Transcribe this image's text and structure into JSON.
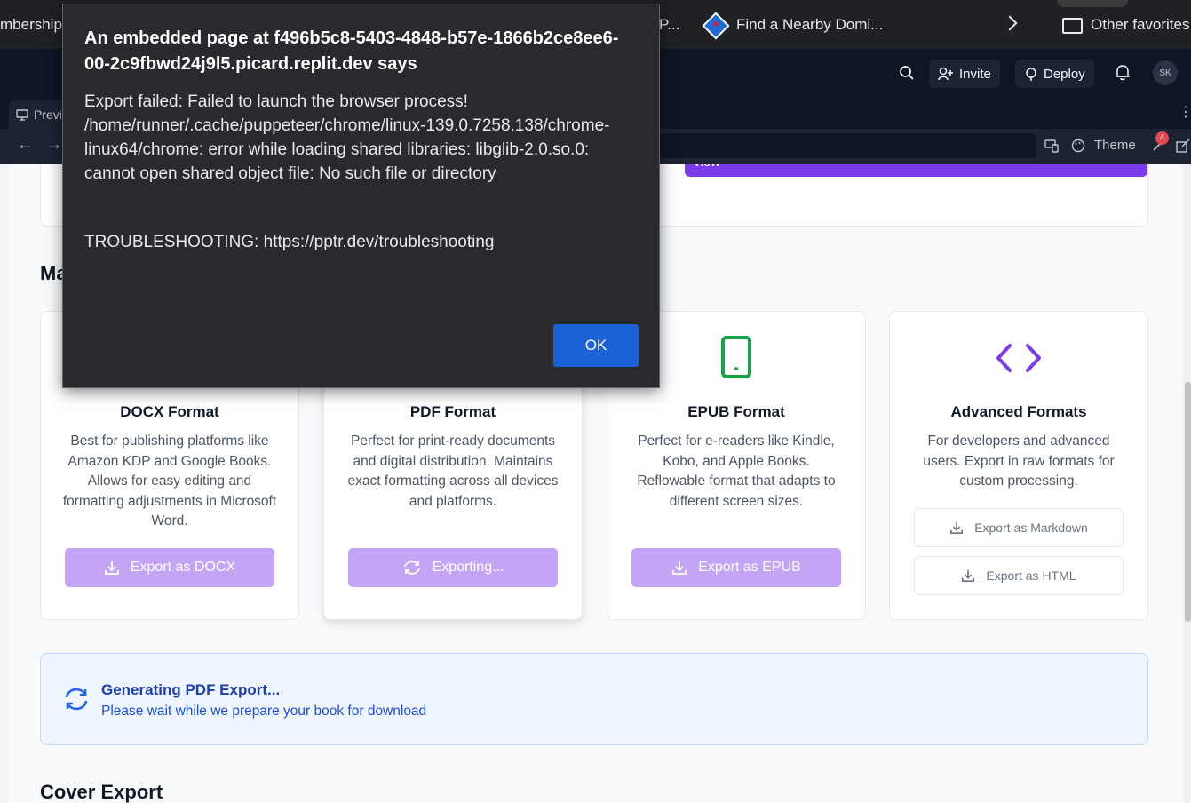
{
  "browser": {
    "bookmarks": [
      {
        "label": "mbership"
      },
      {
        "label": "P..."
      },
      {
        "label": "Find a Nearby Domi..."
      },
      {
        "label": "Other favorites"
      }
    ]
  },
  "replit_header": {
    "invite": "Invite",
    "deploy": "Deploy",
    "avatar": "SK"
  },
  "pane": {
    "tab_label": "Previ",
    "theme": "Theme",
    "badge_count": "4"
  },
  "page": {
    "preview_button": "view",
    "section_heading": "Ma",
    "cards": [
      {
        "title": "DOCX Format",
        "description": "Best for publishing platforms like Amazon KDP and Google Books. Allows for easy editing and formatting adjustments in Microsoft Word.",
        "button": "Export as DOCX"
      },
      {
        "title": "PDF Format",
        "description": "Perfect for print-ready documents and digital distribution. Maintains exact formatting across all devices and platforms.",
        "button": "Exporting..."
      },
      {
        "title": "EPUB Format",
        "description": "Perfect for e-readers like Kindle, Kobo, and Apple Books. Reflowable format that adapts to different screen sizes.",
        "button": "Export as EPUB"
      },
      {
        "title": "Advanced Formats",
        "description": "For developers and advanced users. Export in raw formats for custom processing.",
        "buttons": [
          "Export as Markdown",
          "Export as HTML"
        ]
      }
    ],
    "generating": {
      "title": "Generating PDF Export...",
      "subtitle": "Please wait while we prepare your book for download"
    },
    "cover_heading": "Cover Export"
  },
  "dialog": {
    "title": "An embedded page at f496b5c8-5403-4848-b57e-1866b2ce8ee6-00-2c9fbwd24j9l5.picard.replit.dev says",
    "message": "Export failed: Failed to launch the browser process! /home/runner/.cache/puppeteer/chrome/linux-139.0.7258.138/chrome-linux64/chrome: error while loading shared libraries: libglib-2.0.so.0: cannot open shared object file: No such file or directory",
    "troubleshooting": "TROUBLESHOOTING: https://pptr.dev/troubleshooting",
    "ok": "OK"
  },
  "colors": {
    "accent_purple": "#7c3aed",
    "button_purple_disabled": "#c4a5f5",
    "epub_green": "#16a34a",
    "ok_blue": "#1a62d6"
  },
  "icons": [
    "search-icon",
    "invite-icon",
    "deploy-icon",
    "bell-icon",
    "download-icon",
    "refresh-icon",
    "tablet-icon",
    "code-icon",
    "folder-icon",
    "chevron-right-icon"
  ]
}
